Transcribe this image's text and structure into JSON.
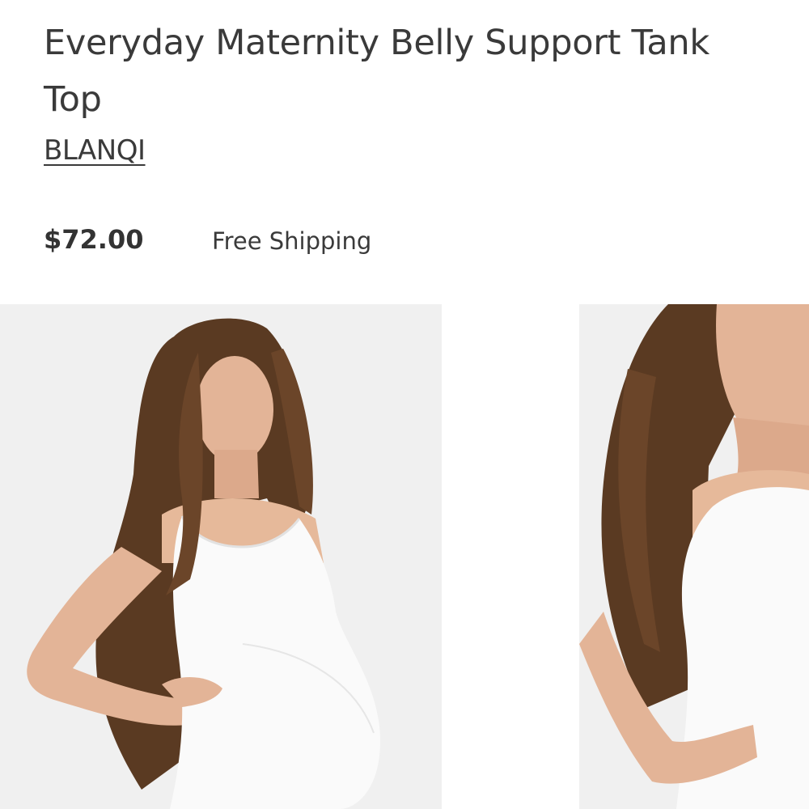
{
  "product": {
    "title": "Everyday Maternity Belly Support Tank Top",
    "brand": "BLANQI",
    "price": "$72.00",
    "shipping": "Free Shipping"
  },
  "gallery": {
    "images": [
      {
        "subject": "pregnant model wearing white tank top, front view"
      },
      {
        "subject": "pregnant model wearing white tank top, close-up side view"
      }
    ]
  },
  "colors": {
    "text": "#3a3a3a",
    "image_background": "#f0f0f0",
    "garment": "#fafafa",
    "hair": "#5a3a22",
    "skin": "#e6b99a"
  }
}
